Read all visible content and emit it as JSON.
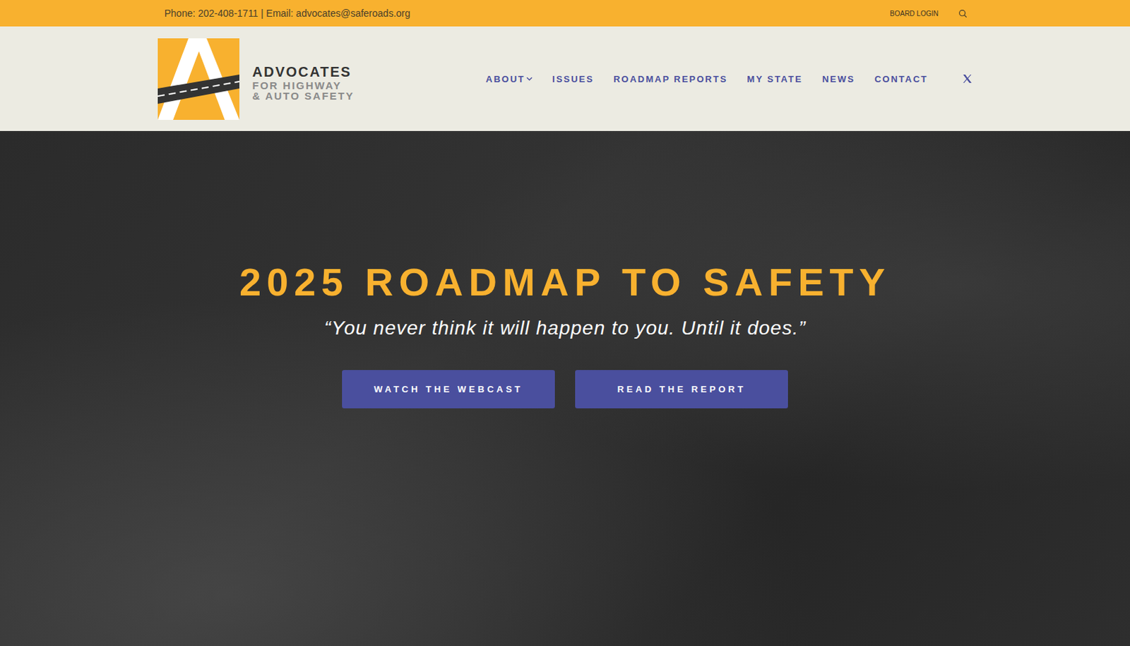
{
  "top_bar": {
    "contact": "Phone: 202-408-1711 | Email: advocates@saferoads.org",
    "board_login": "BOARD LOGIN"
  },
  "logo": {
    "lines": [
      "ADVOCATES",
      "FOR HIGHWAY",
      "& AUTO SAFETY"
    ]
  },
  "nav": [
    {
      "label": "ABOUT",
      "dropdown": true
    },
    {
      "label": "ISSUES",
      "dropdown": false
    },
    {
      "label": "ROADMAP REPORTS",
      "dropdown": false
    },
    {
      "label": "MY STATE",
      "dropdown": false
    },
    {
      "label": "NEWS",
      "dropdown": false
    },
    {
      "label": "CONTACT",
      "dropdown": false
    }
  ],
  "hero": {
    "title": "2025 ROADMAP TO SAFETY",
    "quote": "“You never think it will happen to you. Until it does.”",
    "buttons": [
      "WATCH THE WEBCAST",
      "READ THE REPORT"
    ]
  }
}
